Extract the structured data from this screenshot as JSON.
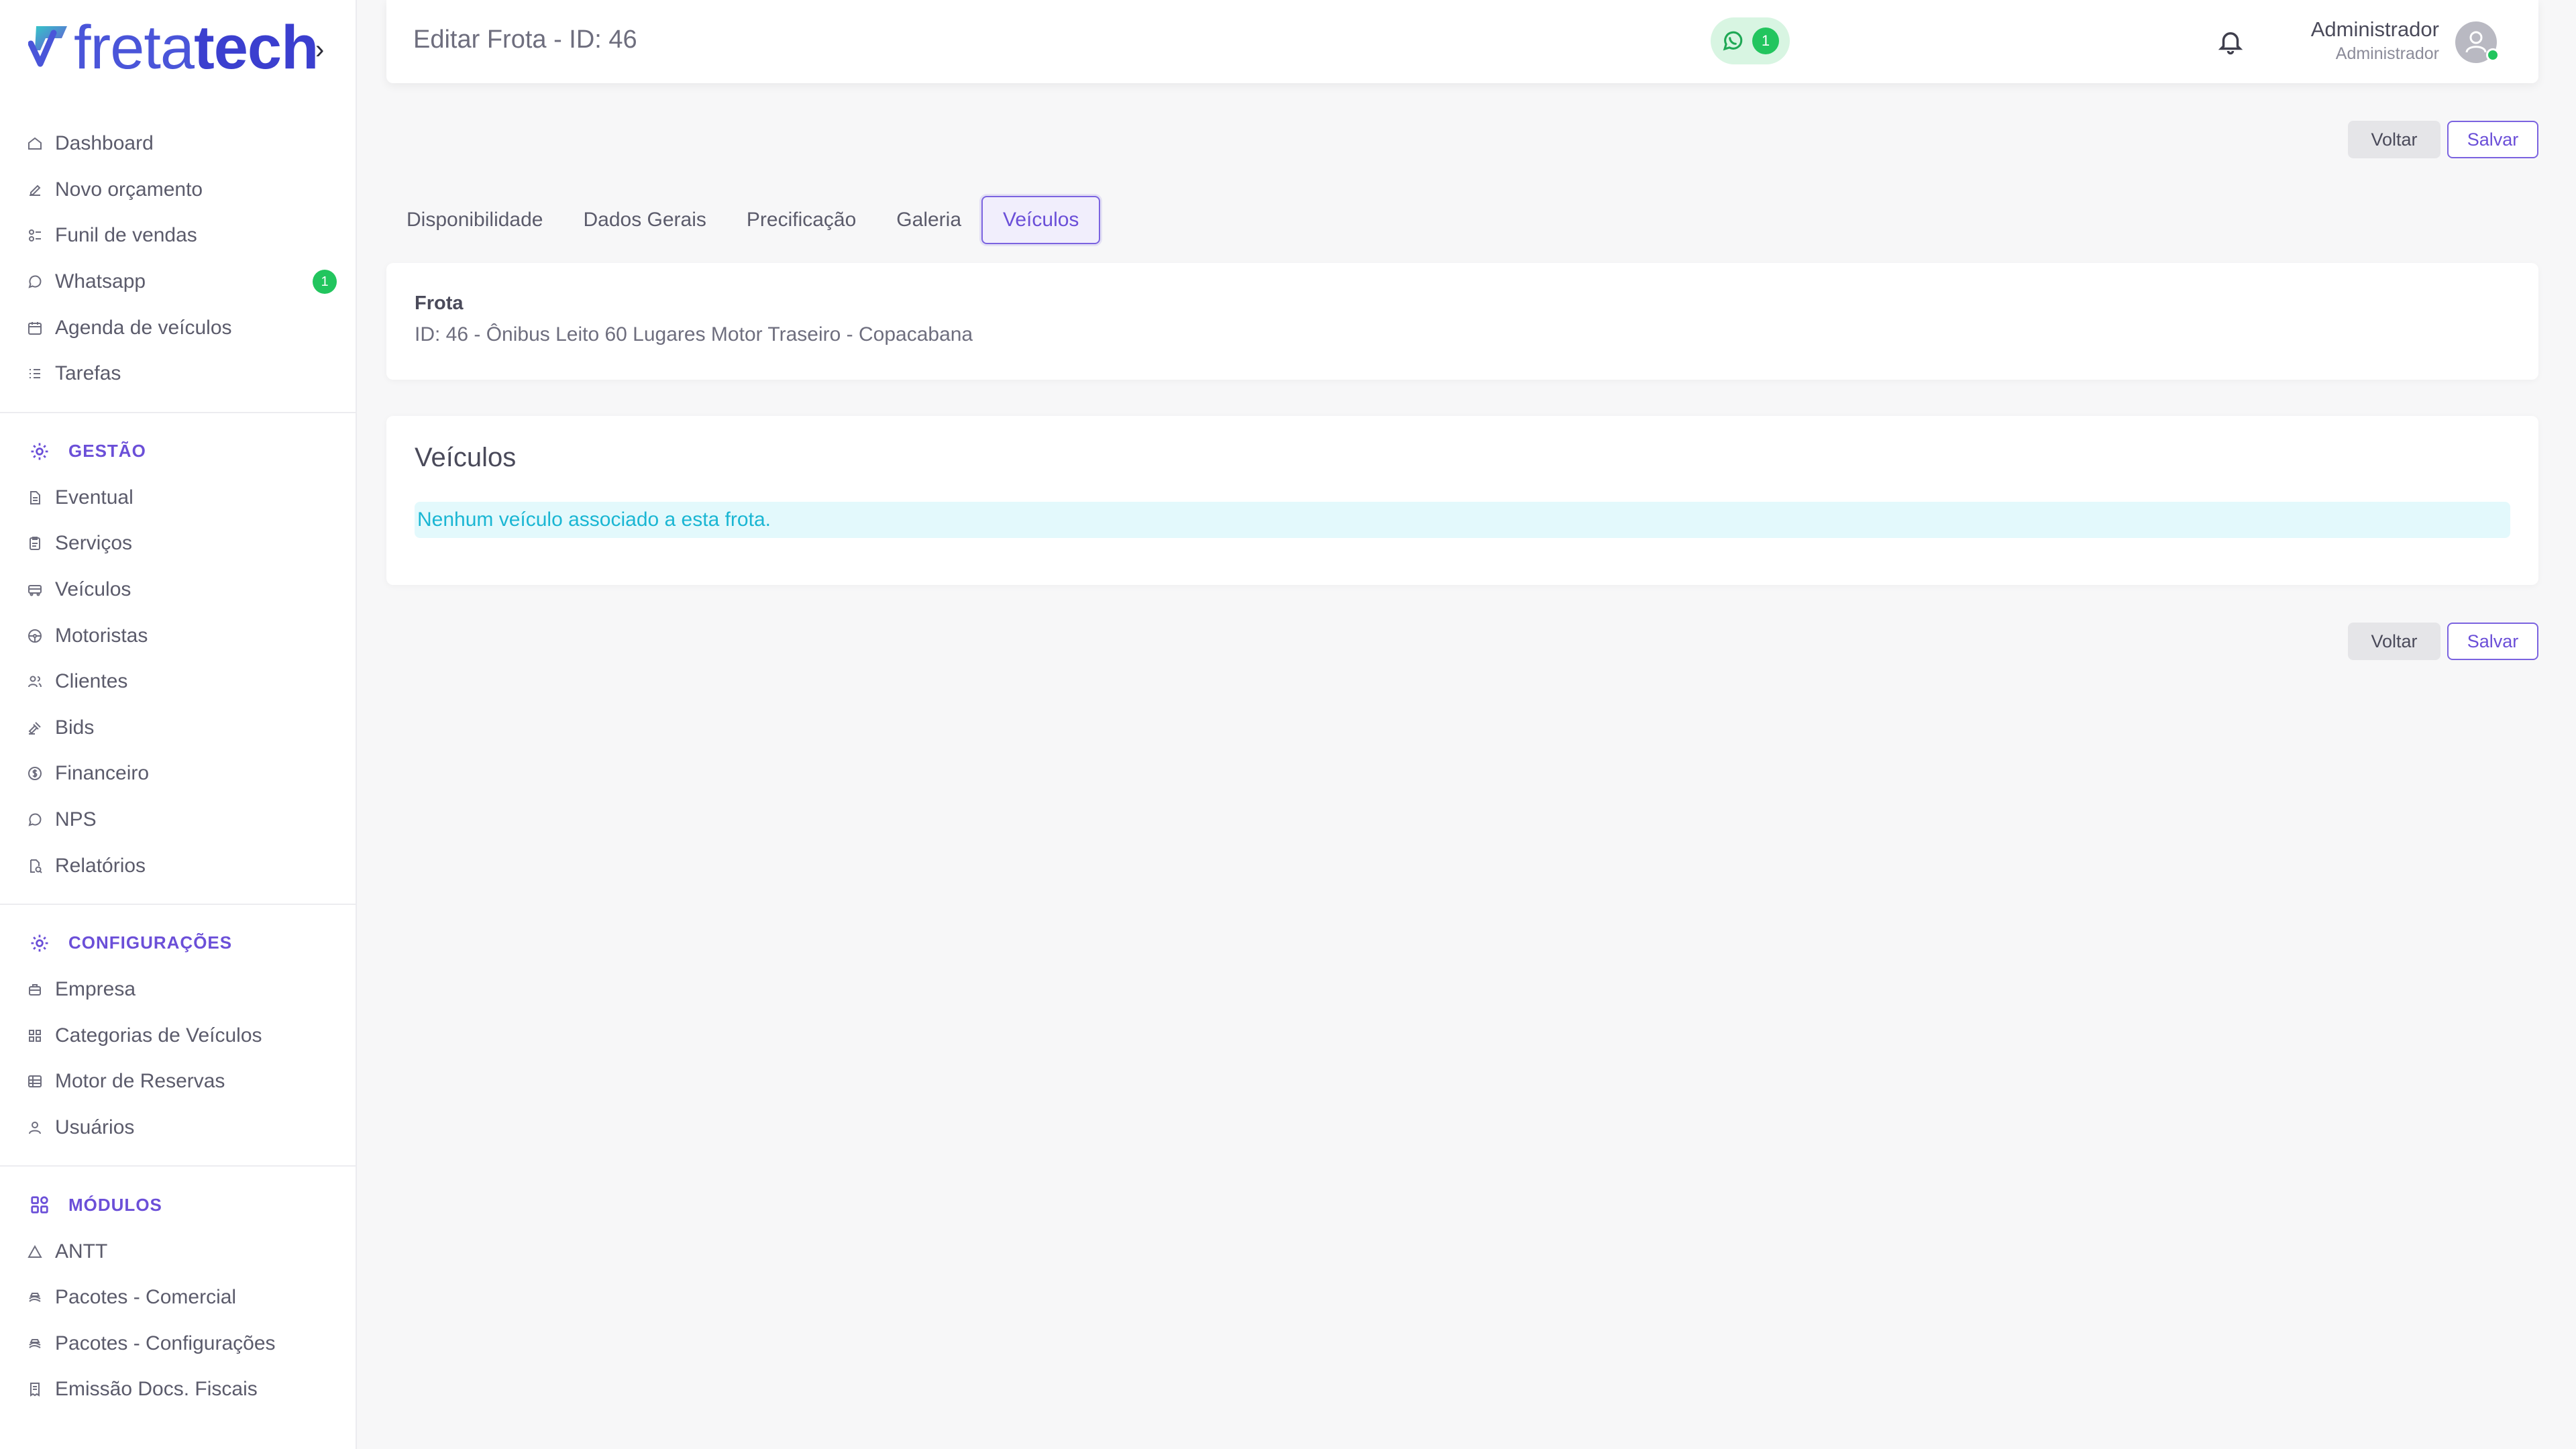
{
  "app": {
    "logo_text_part1": "freta",
    "logo_text_part2": "tech",
    "brand_color": "#4a55d9",
    "accent_color": "#6b4fd8"
  },
  "sidebar": {
    "main_items": [
      {
        "label": "Dashboard",
        "icon": "home-icon"
      },
      {
        "label": "Novo orçamento",
        "icon": "edit-icon"
      },
      {
        "label": "Funil de vendas",
        "icon": "funnel-icon"
      },
      {
        "label": "Whatsapp",
        "icon": "whatsapp-icon",
        "badge": "1"
      },
      {
        "label": "Agenda de veículos",
        "icon": "calendar-icon"
      },
      {
        "label": "Tarefas",
        "icon": "list-icon"
      }
    ],
    "gestao": {
      "title": "GESTÃO",
      "items": [
        {
          "label": "Eventual",
          "icon": "document-icon"
        },
        {
          "label": "Serviços",
          "icon": "clipboard-icon"
        },
        {
          "label": "Veículos",
          "icon": "bus-icon"
        },
        {
          "label": "Motoristas",
          "icon": "steering-wheel-icon"
        },
        {
          "label": "Clientes",
          "icon": "users-icon"
        },
        {
          "label": "Bids",
          "icon": "gavel-icon"
        },
        {
          "label": "Financeiro",
          "icon": "coin-icon"
        },
        {
          "label": "NPS",
          "icon": "chat-icon"
        },
        {
          "label": "Relatórios",
          "icon": "report-icon"
        }
      ]
    },
    "configuracoes": {
      "title": "CONFIGURAÇÕES",
      "items": [
        {
          "label": "Empresa",
          "icon": "building-icon"
        },
        {
          "label": "Categorias de Veículos",
          "icon": "grid-icon"
        },
        {
          "label": "Motor de Reservas",
          "icon": "table-icon"
        },
        {
          "label": "Usuários",
          "icon": "user-icon"
        }
      ]
    },
    "modulos": {
      "title": "MÓDULOS",
      "items": [
        {
          "label": "ANTT",
          "icon": "triangle-icon"
        },
        {
          "label": "Pacotes - Comercial",
          "icon": "package-icon"
        },
        {
          "label": "Pacotes - Configurações",
          "icon": "package-icon"
        },
        {
          "label": "Emissão Docs. Fiscais",
          "icon": "receipt-icon"
        }
      ]
    }
  },
  "header": {
    "title": "Editar Frota - ID: 46",
    "whatsapp_count": "1",
    "user_name": "Administrador",
    "user_role": "Administrador"
  },
  "actions": {
    "back_label": "Voltar",
    "save_label": "Salvar"
  },
  "tabs": [
    {
      "label": "Disponibilidade",
      "active": false
    },
    {
      "label": "Dados Gerais",
      "active": false
    },
    {
      "label": "Precificação",
      "active": false
    },
    {
      "label": "Galeria",
      "active": false
    },
    {
      "label": "Veículos",
      "active": true
    }
  ],
  "frota_card": {
    "label": "Frota",
    "value": "ID: 46 - Ônibus Leito 60 Lugares Motor Traseiro - Copacabana"
  },
  "veiculos_card": {
    "title": "Veículos",
    "empty_message": "Nenhum veículo associado a esta frota."
  }
}
